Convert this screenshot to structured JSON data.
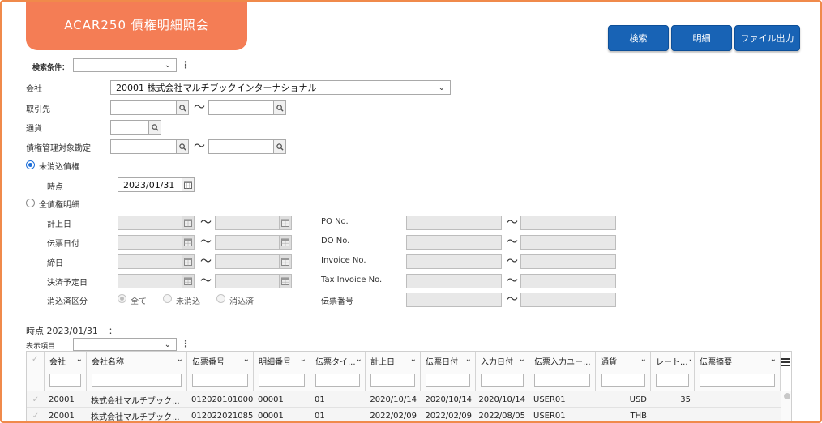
{
  "title": "ACAR250 債権明細照会",
  "buttons": {
    "search": "検索",
    "detail": "明細",
    "file_output": "ファイル出力"
  },
  "search_conditions": {
    "label": "検索条件：",
    "value": ""
  },
  "form": {
    "company": {
      "label": "会社",
      "value": "20001 株式会社マルチブックインターナショナル"
    },
    "partner": {
      "label": "取引先"
    },
    "currency": {
      "label": "通貨"
    },
    "account": {
      "label": "債権管理対象勘定"
    },
    "tilde": "～",
    "unsettled": {
      "label": "未消込債権",
      "point_label": "時点",
      "point_value": "2023/01/31"
    },
    "all_detail": {
      "label": "全債権明細"
    },
    "posting_date": "計上日",
    "slip_date": "伝票日付",
    "closing_date": "締日",
    "settle_date": "決済予定日",
    "settle_class": "消込済区分",
    "settle_options": [
      "全て",
      "未消込",
      "消込済"
    ],
    "po_no": "PO No.",
    "do_no": "DO No.",
    "invoice_no": "Invoice No.",
    "tax_invoice_no": "Tax Invoice No.",
    "slip_no": "伝票番号"
  },
  "result": {
    "point_text": "時点 2023/01/31",
    "colon": "：",
    "display_items_label": "表示項目"
  },
  "grid": {
    "columns": [
      "会社",
      "会社名称",
      "伝票番号",
      "明細番号",
      "伝票タイ...",
      "計上日",
      "伝票日付",
      "入力日付",
      "伝票入力ユー...",
      "通貨",
      "レート...",
      "伝票摘要"
    ],
    "rows": [
      [
        "20001",
        "株式会社マルチブック...",
        "012020101000",
        "00001",
        "01",
        "2020/10/14",
        "2020/10/14",
        "2020/10/14",
        "USER01",
        "USD",
        "35",
        ""
      ],
      [
        "20001",
        "株式会社マルチブック...",
        "012022021085",
        "00001",
        "01",
        "2022/02/09",
        "2022/02/09",
        "2022/08/05",
        "USER01",
        "THB",
        "",
        ""
      ]
    ]
  },
  "colors": {
    "title_bg": "#f47d55",
    "button_bg": "#1863b5",
    "frame": "#f08a4b",
    "radio_on": "#1e6fd9"
  }
}
